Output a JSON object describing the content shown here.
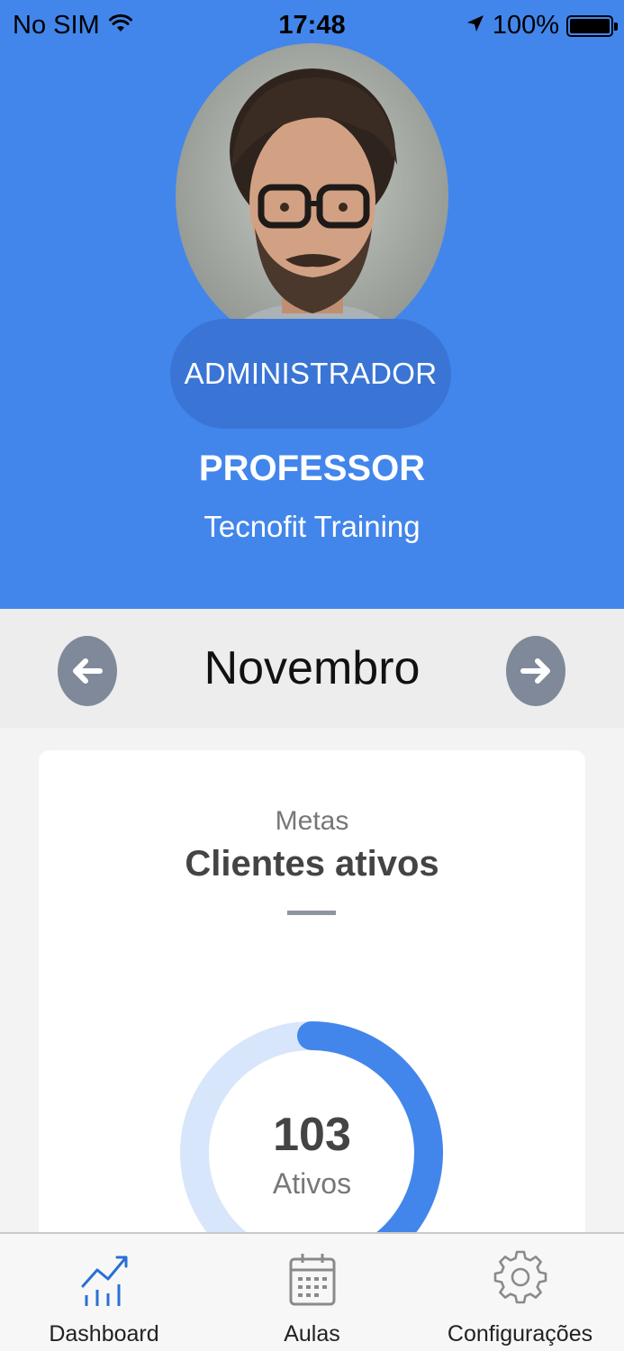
{
  "status_bar": {
    "carrier": "No SIM",
    "time": "17:48",
    "battery": "100%",
    "wifi_icon": "wifi-icon",
    "location_icon": "location-arrow-icon",
    "battery_icon": "battery-icon"
  },
  "profile": {
    "role": "ADMINISTRADOR",
    "name": "PROFESSOR",
    "company": "Tecnofit Training"
  },
  "month_selector": {
    "month": "Novembro",
    "prev_icon": "arrow-left-circle-icon",
    "next_icon": "arrow-right-circle-icon"
  },
  "goals_card": {
    "kicker": "Metas",
    "title": "Clientes ativos",
    "value": "103",
    "caption": "Ativos",
    "progress_fraction": 0.44,
    "colors": {
      "progress": "#4286eb",
      "track": "#d8e6fb"
    }
  },
  "tabs": [
    {
      "label": "Dashboard",
      "icon": "chart-trend-icon",
      "active": true
    },
    {
      "label": "Aulas",
      "icon": "calendar-icon",
      "active": false
    },
    {
      "label": "Configurações",
      "icon": "gear-icon",
      "active": false
    }
  ],
  "colors": {
    "header": "#4286eb",
    "pill": "#3a75d6",
    "nav_button": "#7f899a",
    "active_tab": "#2a6fd4"
  }
}
